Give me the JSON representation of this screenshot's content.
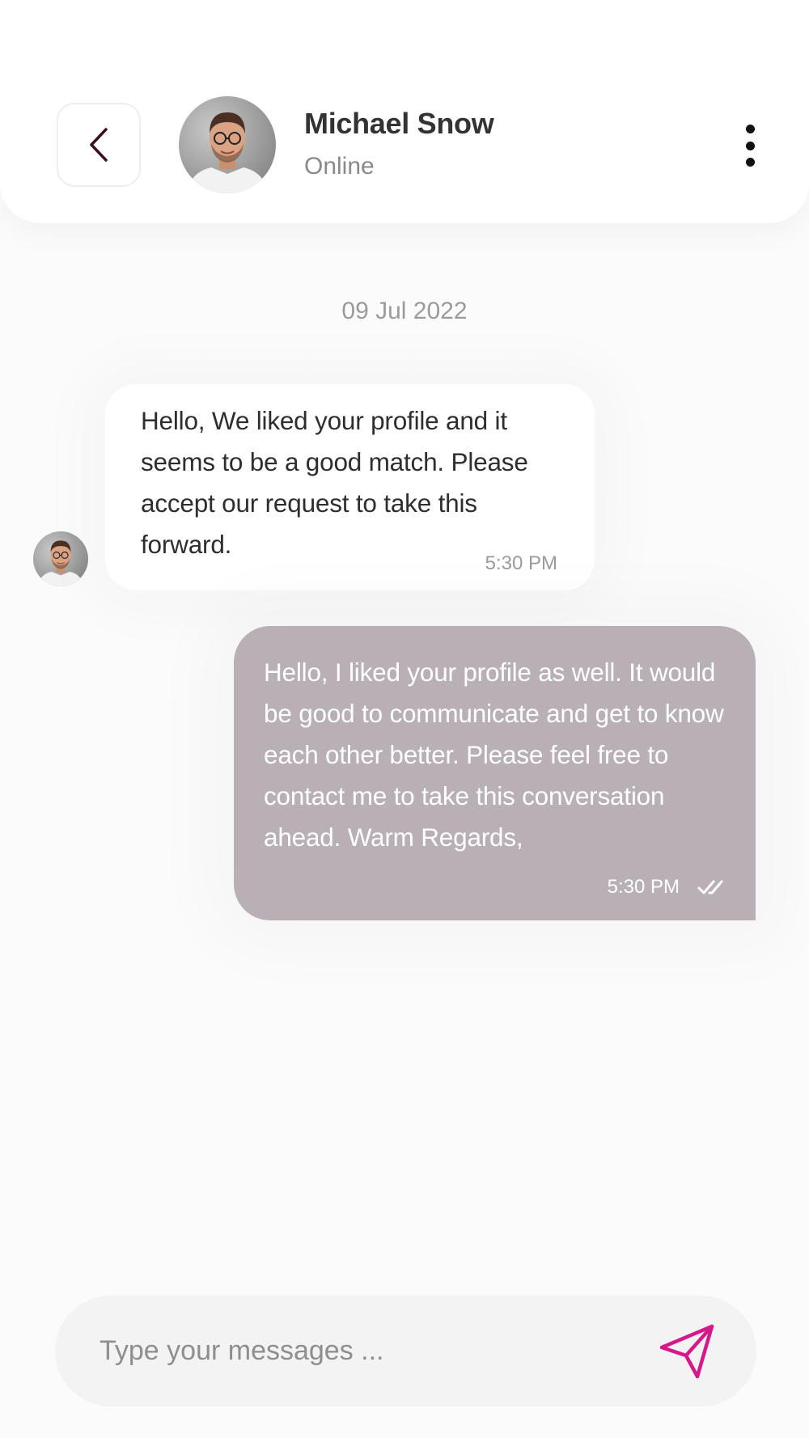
{
  "header": {
    "contact_name": "Michael Snow",
    "status": "Online",
    "back_icon": "chevron-left-icon",
    "more_icon": "more-vertical-icon"
  },
  "conversation": {
    "date": "09 Jul 2022",
    "messages": [
      {
        "direction": "incoming",
        "text": "Hello, We liked your profile and it seems to be a good match. Please accept our request to take this forward.",
        "time": "5:30 PM"
      },
      {
        "direction": "outgoing",
        "text": "Hello, I liked your profile as well. It would be good to communicate and get to know each other better. Please feel free to contact me to take this conversation ahead. Warm Regards,",
        "time": "5:30 PM",
        "status_icon": "double-check-icon"
      }
    ]
  },
  "composer": {
    "placeholder": "Type your messages ...",
    "value": "",
    "send_icon": "send-icon"
  },
  "colors": {
    "background": "#fcfbfb",
    "outgoing_bubble": "#b8b0b5",
    "incoming_bubble": "#ffffff",
    "accent": "#d6198a",
    "back_chevron": "#3a0f22"
  }
}
